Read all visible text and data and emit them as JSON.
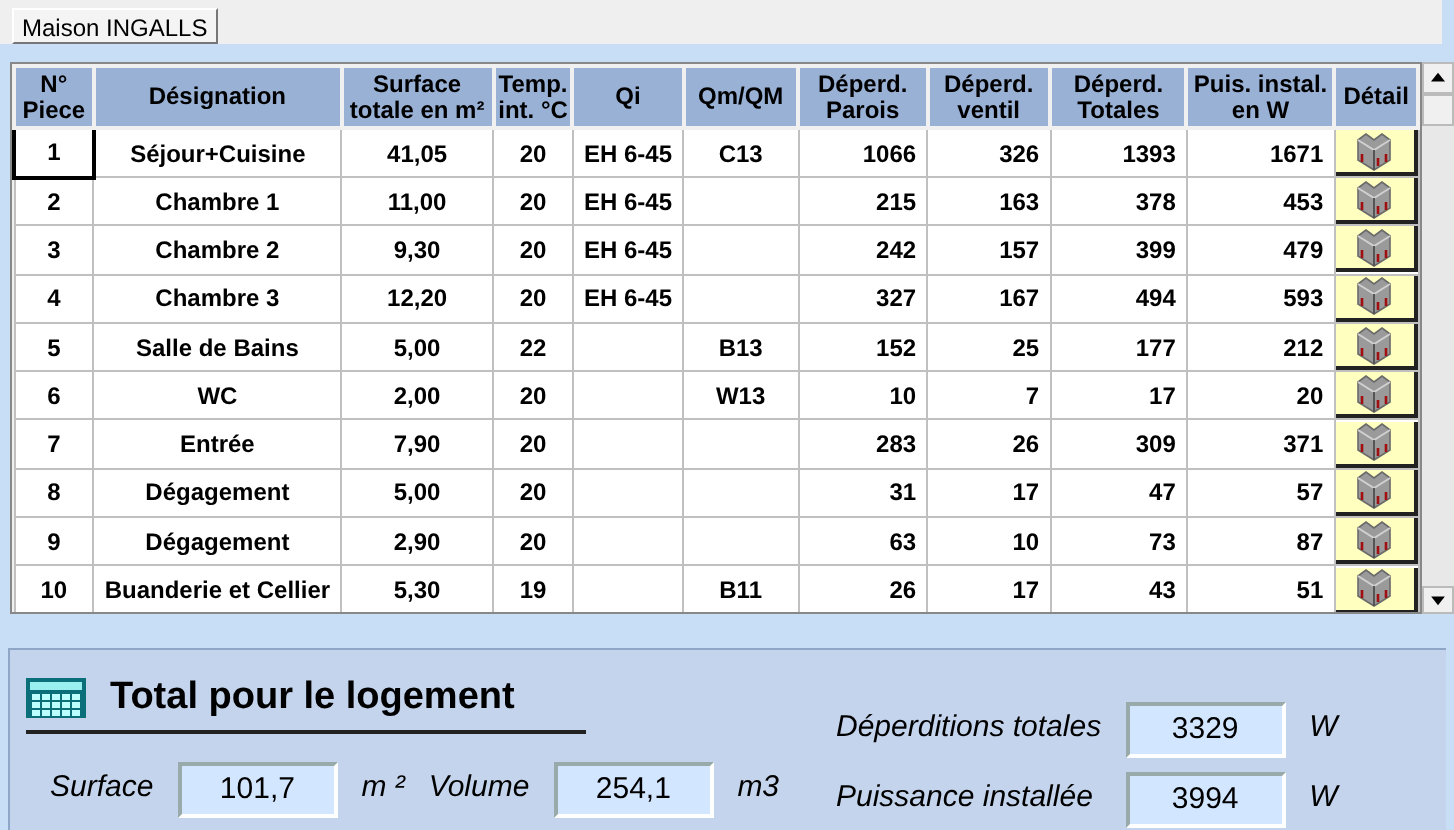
{
  "tab": {
    "label": "Maison INGALLS",
    "selected": true
  },
  "table": {
    "columns": [
      "N° Piece",
      "Désignation",
      "Surface totale en m²",
      "Temp. int. °C",
      "Qi",
      "Qm/QM",
      "Déperd. Parois",
      "Déperd. ventil",
      "Déperd. Totales",
      "Puis. instal. en W",
      "Détail"
    ],
    "rows": [
      {
        "cells": [
          "1",
          "Séjour+Cuisine",
          "41,05",
          "20",
          "EH 6-45",
          "C13",
          "1066",
          "326",
          "1393",
          "1671"
        ],
        "selected": true
      },
      {
        "cells": [
          "2",
          "Chambre 1",
          "11,00",
          "20",
          "EH 6-45",
          "",
          "215",
          "163",
          "378",
          "453"
        ],
        "selected": false
      },
      {
        "cells": [
          "3",
          "Chambre 2",
          "9,30",
          "20",
          "EH 6-45",
          "",
          "242",
          "157",
          "399",
          "479"
        ],
        "selected": false
      },
      {
        "cells": [
          "4",
          "Chambre 3",
          "12,20",
          "20",
          "EH 6-45",
          "",
          "327",
          "167",
          "494",
          "593"
        ],
        "selected": false
      },
      {
        "cells": [
          "5",
          "Salle de Bains",
          "5,00",
          "22",
          "",
          "B13",
          "152",
          "25",
          "177",
          "212"
        ],
        "selected": false
      },
      {
        "cells": [
          "6",
          "WC",
          "2,00",
          "20",
          "",
          "W13",
          "10",
          "7",
          "17",
          "20"
        ],
        "selected": false
      },
      {
        "cells": [
          "7",
          "Entrée",
          "7,90",
          "20",
          "",
          "",
          "283",
          "26",
          "309",
          "371"
        ],
        "selected": false
      },
      {
        "cells": [
          "8",
          "Dégagement",
          "5,00",
          "20",
          "",
          "",
          "31",
          "17",
          "47",
          "57"
        ],
        "selected": false
      },
      {
        "cells": [
          "9",
          "Dégagement",
          "2,90",
          "20",
          "",
          "",
          "63",
          "10",
          "73",
          "87"
        ],
        "selected": false
      },
      {
        "cells": [
          "10",
          "Buanderie et Cellier",
          "5,30",
          "19",
          "",
          "B11",
          "26",
          "17",
          "43",
          "51"
        ],
        "selected": false
      }
    ]
  },
  "totals": {
    "title": "Total pour le logement",
    "surface": {
      "label": "Surface",
      "value": "101,7",
      "unit": "m ²"
    },
    "volume": {
      "label": "Volume",
      "value": "254,1",
      "unit": "m3"
    },
    "losses": {
      "label": "Déperditions totales",
      "value": "3329",
      "unit": "W"
    },
    "power": {
      "label": "Puissance installée",
      "value": "3994",
      "unit": "W"
    }
  }
}
